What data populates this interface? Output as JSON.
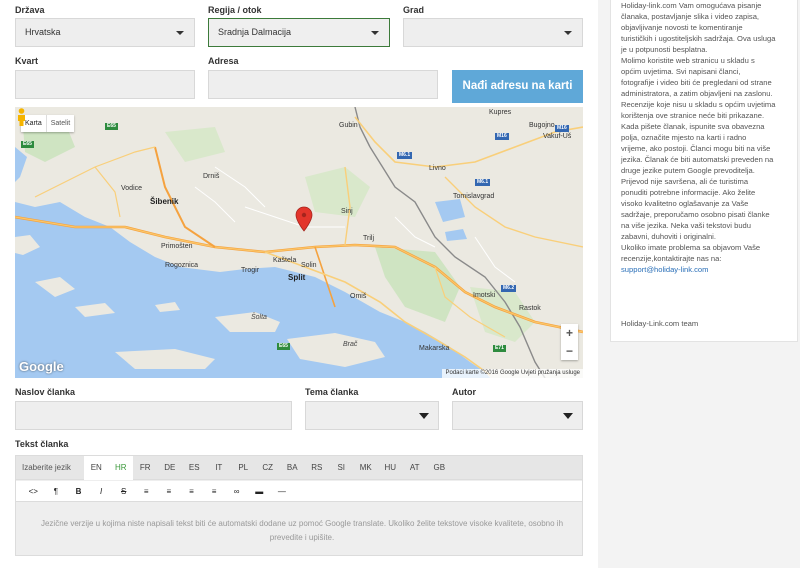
{
  "form": {
    "country_label": "Država",
    "country_value": "Hrvatska",
    "region_label": "Regija / otok",
    "region_value": "Sradnja Dalmacija",
    "city_label": "Grad",
    "city_value": "",
    "district_label": "Kvart",
    "district_value": "",
    "address_label": "Adresa",
    "address_value": "",
    "find_button": "Nađi adresu na karti",
    "article_title_label": "Naslov članka",
    "article_theme_label": "Tema članka",
    "author_label": "Autor",
    "article_text_label": "Tekst članka"
  },
  "map": {
    "type_map": "Karta",
    "type_satellite": "Satelit",
    "logo": "Google",
    "attribution": "Podaci karte ©2016 Google    Uvjeti pružanja usluge",
    "zoom_in": "+",
    "zoom_out": "−",
    "cities": {
      "gubin": "Gubin",
      "kupres": "Kupres",
      "bugojno": "Bugojno",
      "vakuf": "Vakuf-Uš",
      "livno": "Livno",
      "tomislavgrad": "Tomislavgrad",
      "drnis": "Drniš",
      "vodice": "Vodice",
      "sibenik": "Šibenik",
      "sinj": "Sinj",
      "trilj": "Trilj",
      "primosten": "Primošten",
      "rogoznica": "Rogoznica",
      "trogir": "Trogir",
      "kastela": "Kaštela",
      "solin": "Solin",
      "split": "Split",
      "omis": "Omiš",
      "imotski": "Imotski",
      "solta": "Šolta",
      "brac": "Brač",
      "makarska": "Makarska",
      "rastok": "Rastok",
      "ka": "Ka"
    },
    "signs": {
      "m16a": "M16",
      "m16b": "M16",
      "m61a": "M6.1",
      "m61b": "M6.1",
      "m62": "M6.2",
      "e65a": "E65",
      "e65b": "E65",
      "e71": "E71",
      "e65c": "E65"
    }
  },
  "editor": {
    "lang_label": "Izaberite jezik",
    "languages": [
      "EN",
      "HR",
      "FR",
      "DE",
      "ES",
      "IT",
      "PL",
      "CZ",
      "BA",
      "RS",
      "SI",
      "MK",
      "HU",
      "AT",
      "GB"
    ],
    "active_language": "HR",
    "toolbar": [
      "<>",
      "¶",
      "B",
      "I",
      "S",
      "≡",
      "≡",
      "≡",
      "≡",
      "∞",
      "▬",
      "—"
    ],
    "placeholder": "Jezične verzije u kojima niste napisali tekst biti će automatski dodane uz pomoć Google translate. Ukoliko želite tekstove visoke kvalitete, osobno ih prevedite i upišite."
  },
  "sidebar": {
    "text": "Holiday-link.com Vam omogućava pisanje\nčlanaka, postavljanje slika i video zapisa,\nobjavljivanje novosti te komentiranje\nturističkih i ugostiteljskih sadržaja. Ova usluga\nje u potpunosti besplatna.\nMolimo koristite web stranicu u skladu s\nopćim uvjetima. Svi napisani članci,\nfotografije i video biti će pregledani od strane\nadministratora, a zatim objavljeni na zaslonu.\nRecenzije koje nisu u skladu s općim uvjetima\nkorištenja ove stranice neće biti prikazane.\nKada pišete članak, ispunite sva obavezna\npolja, označite mjesto na karti i radno\nvrijeme, ako postoji. Članci mogu biti na više\njezika. Članak će biti automatski preveden na\ndruge jezike putem Google prevoditelja.\nPrijevod nije savršena, ali će turistima\nponuditi potrebne informacije. Ako želite\nvisoko kvalitetno oglašavanje za Vaše\nsadržaje, preporučamo osobno pisati članke\nna više jezika. Neka vaši tekstovi budu\nzabavni, duhoviti i originalni.\nUkoliko imate problema sa objavom Vaše\nrecenzije,kontaktirajte nas na:",
    "email": "support@holiday-link.com",
    "team": "Holiday-Link.com team"
  }
}
